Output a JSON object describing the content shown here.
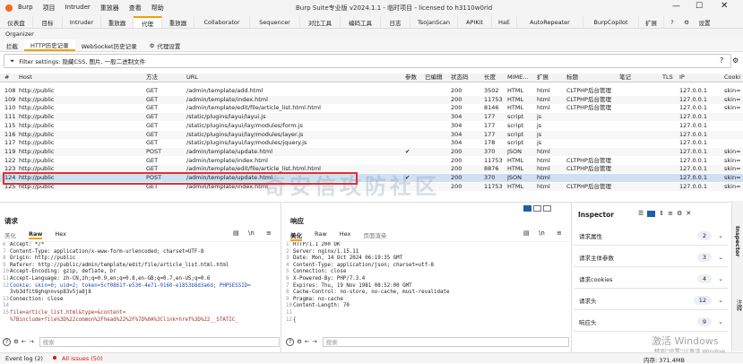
{
  "app": {
    "name": "Burp",
    "window_title": "Burp Suite专业版  v2024.1.1 - 临时项目 - licensed to h3110w0rld",
    "menu": [
      "项目",
      "Intruder",
      "重放器",
      "查看",
      "帮助"
    ]
  },
  "main_tabs": [
    "仪表盘",
    "目标",
    "Intruder",
    "重放器",
    "代理",
    "重放器",
    "Collaborator",
    "Sequencer",
    "对比工具",
    "编码工具",
    "日志",
    "TsojanScan",
    "APIKit",
    "HaE",
    "AutoRepeater",
    "BurpCopilot",
    "扩展"
  ],
  "settings_label": "设置",
  "organizer_label": "Organizer",
  "proxy_tabs": [
    "拦截",
    "HTTP历史记录",
    "WebSocket历史记录"
  ],
  "proxy_settings_label": "代理设置",
  "filter": {
    "text": "Filter settings: 隐藏CSS, 图片, 一般二进制文件"
  },
  "table": {
    "headers": [
      "#",
      "Host",
      "方法",
      "URL",
      "参数",
      "已编辑",
      "状态码",
      "长度",
      "MIME...",
      "扩展",
      "标题",
      "笔记",
      "TLS",
      "IP",
      "Cooki"
    ],
    "rows": [
      [
        "108",
        "http://public",
        "GET",
        "/admin/template/add.html",
        "",
        "",
        "200",
        "3502",
        "HTML",
        "html",
        "CLTPHP后台管理",
        "",
        "",
        "127.0.0.1",
        "skin="
      ],
      [
        "109",
        "http://public",
        "GET",
        "/admin/template/index.html",
        "",
        "",
        "200",
        "11753",
        "HTML",
        "html",
        "CLTPHP后台管理",
        "",
        "",
        "127.0.0.1",
        "skin="
      ],
      [
        "110",
        "http://public",
        "GET",
        "/admin/template/edit/file/article_list.html.html",
        "",
        "",
        "200",
        "8146",
        "HTML",
        "html",
        "CLTPHP后台管理",
        "",
        "",
        "127.0.0.1",
        "skin="
      ],
      [
        "111",
        "http://public",
        "GET",
        "/static/plugins/layui/layui.js",
        "",
        "",
        "304",
        "177",
        "script",
        "js",
        "",
        "",
        "",
        "127.0.0.1",
        ""
      ],
      [
        "115",
        "http://public",
        "GET",
        "/static/plugins/layui/lay/modules/form.js",
        "",
        "",
        "304",
        "177",
        "script",
        "js",
        "",
        "",
        "",
        "127.0.0.1",
        ""
      ],
      [
        "116",
        "http://public",
        "GET",
        "/static/plugins/layui/lay/modules/layer.js",
        "",
        "",
        "304",
        "177",
        "script",
        "js",
        "",
        "",
        "",
        "127.0.0.1",
        ""
      ],
      [
        "117",
        "http://public",
        "GET",
        "/static/plugins/layui/lay/modules/jquery.js",
        "",
        "",
        "304",
        "178",
        "script",
        "js",
        "",
        "",
        "",
        "127.0.0.1",
        ""
      ],
      [
        "119",
        "http://public",
        "POST",
        "/admin/template/update.html",
        "✔",
        "",
        "200",
        "370",
        "JSON",
        "html",
        "",
        "",
        "",
        "127.0.0.1",
        "skin="
      ],
      [
        "122",
        "http://public",
        "GET",
        "/admin/template/index.html",
        "",
        "",
        "200",
        "11753",
        "HTML",
        "html",
        "CLTPHP后台管理",
        "",
        "",
        "127.0.0.1",
        "skin="
      ],
      [
        "123",
        "http://public",
        "GET",
        "/admin/template/edit/file/article_list.html.html",
        "",
        "",
        "200",
        "8876",
        "HTML",
        "html",
        "CLTPHP后台管理",
        "",
        "",
        "127.0.0.1",
        "skin="
      ],
      [
        "124",
        "http://public",
        "POST",
        "/admin/template/update.html",
        "✔",
        "",
        "200",
        "370",
        "JSON",
        "html",
        "",
        "",
        "",
        "127.0.0.1",
        "skin="
      ],
      [
        "125",
        "http://public",
        "GET",
        "/admin/template/index.html",
        "",
        "",
        "200",
        "11753",
        "HTML",
        "html",
        "CLTPHP后台管理",
        "",
        "",
        "127.0.0.1",
        "skin="
      ]
    ]
  },
  "watermark": "奇安信攻防社区",
  "request": {
    "title": "请求",
    "tabs": [
      "美化",
      "Raw",
      "Hex"
    ],
    "newline_label": "\\n",
    "lines": [
      {
        "n": "6",
        "text": "Accept: */*"
      },
      {
        "n": "7",
        "text": "Content-Type: application/x-www-form-urlencoded; charset=UTF-8"
      },
      {
        "n": "8",
        "text": "Origin: http://public"
      },
      {
        "n": "9",
        "text": "Referer: http://public/admin/template/edit/file/article_list.html.html"
      },
      {
        "n": "10",
        "text": "Accept-Encoding: gzip, deflate, br"
      },
      {
        "n": "11",
        "text": "Accept-Language: zh-CN,zh;q=0.9,en;q=0.8,en-GB;q=0.7,en-US;q=0.6"
      },
      {
        "n": "12",
        "text": "Cookie: skin=0; uid=2; token=5cf0861f-e530-4e71-9160-e1853b8d3a6d; PHPSESSID="
      },
      {
        "n": "",
        "text": "3vb3dfit8ghqnnvsp83v5ja8j8"
      },
      {
        "n": "13",
        "text": "Connection: close"
      },
      {
        "n": "14",
        "text": ""
      },
      {
        "n": "15",
        "text": "file=article_list.html&type=&content="
      },
      {
        "n": "",
        "text": "%7Binclude+file%3D%22common%2Fhead%22%2F%7D%0A%3Clink+href%3D%22__STATIC_"
      }
    ]
  },
  "response": {
    "title": "响应",
    "tabs": [
      "美化",
      "Raw",
      "Hex",
      "页面渲染"
    ],
    "newline_label": "\\n",
    "lines": [
      {
        "n": "1",
        "text": "HTTP/1.1 200 OK"
      },
      {
        "n": "2",
        "text": "Server: nginx/1.15.11"
      },
      {
        "n": "3",
        "text": "Date: Mon, 14 Oct 2024 06:19:35 GMT"
      },
      {
        "n": "4",
        "text": "Content-Type: application/json; charset=utf-8"
      },
      {
        "n": "5",
        "text": "Connection: close"
      },
      {
        "n": "6",
        "text": "X-Powered-By: PHP/7.3.4"
      },
      {
        "n": "7",
        "text": "Expires: Thu, 19 Nov 1981 08:52:00 GMT"
      },
      {
        "n": "8",
        "text": "Cache-Control: no-store, no-cache, must-revalidate"
      },
      {
        "n": "9",
        "text": "Pragma: no-cache"
      },
      {
        "n": "10",
        "text": "Content-Length: 70"
      },
      {
        "n": "11",
        "text": ""
      },
      {
        "n": "12",
        "text": "{"
      }
    ]
  },
  "search": {
    "placeholder": "搜索"
  },
  "inspector": {
    "title": "Inspector",
    "sidebar_label": "Inspector",
    "sidebar_label2": "注释",
    "rows": [
      {
        "label": "请求属性",
        "count": "2"
      },
      {
        "label": "请求主体参数",
        "count": "3"
      },
      {
        "label": "请求cookies",
        "count": "4"
      },
      {
        "label": "请求头",
        "count": "12"
      },
      {
        "label": "响应头",
        "count": "9"
      }
    ]
  },
  "statusbar": {
    "event_log": "Event log (2)",
    "all_issues": "All issues (50)",
    "memory": "内存: 371.4MB",
    "win_activate": "激活 Windows",
    "win_hint": "转到\"设置\"以激活 Window"
  },
  "colors": {
    "accent": "#f4a000",
    "selected_row": "#cfe0f3",
    "highlight_box": "#e03030",
    "status_red": "#d11"
  }
}
